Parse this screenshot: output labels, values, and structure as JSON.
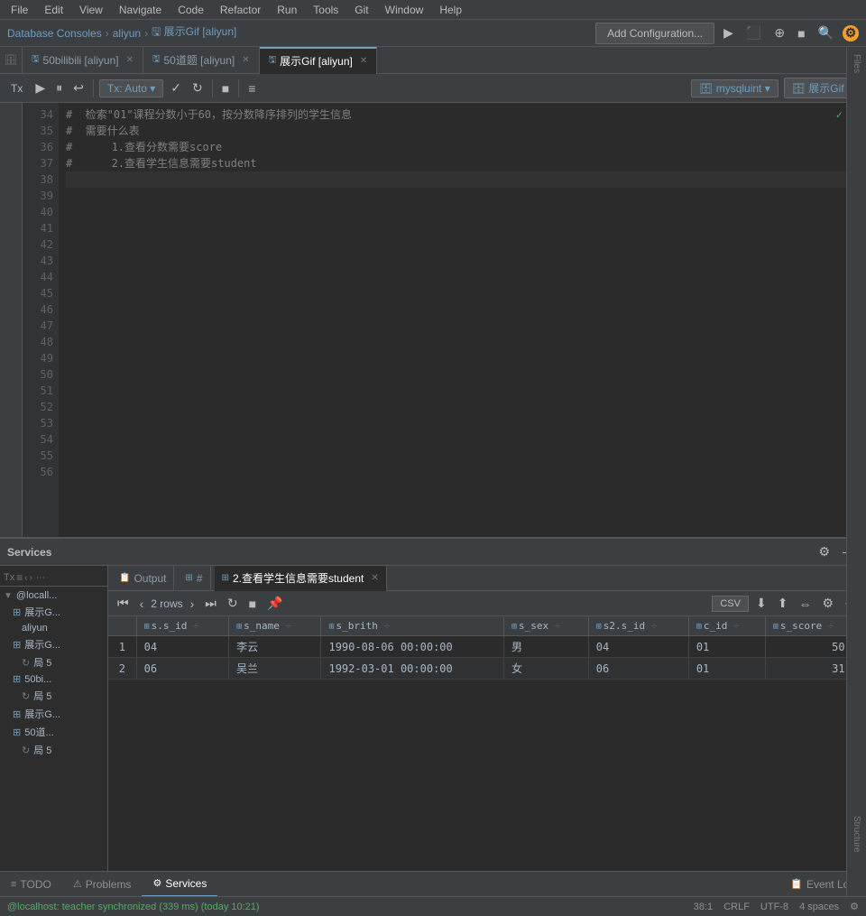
{
  "menu": {
    "items": [
      "File",
      "Edit",
      "View",
      "Navigate",
      "Code",
      "Refactor",
      "Run",
      "Tools",
      "Git",
      "Window",
      "Help"
    ]
  },
  "titlebar": {
    "breadcrumb": [
      "Database Consoles",
      "aliyun",
      "展示Gif [aliyun]"
    ],
    "add_config_label": "Add Configuration...",
    "run_icon": "▶",
    "db_label": "mysqluint",
    "schema_label": "展示Gif"
  },
  "editor_tabs": [
    {
      "label": "50bilibili [aliyun]",
      "active": false
    },
    {
      "label": "50道题 [aliyun]",
      "active": false
    },
    {
      "label": "展示Gif [aliyun]",
      "active": true
    }
  ],
  "toolbar": {
    "tx_label": "Tx",
    "auto_label": "Auto",
    "execute_label": "▶",
    "format_label": "≡"
  },
  "code_lines": [
    {
      "num": 34,
      "text": "#  检索\"01\"课程分数小于60，按分数降序排列的学生信息",
      "type": "comment",
      "check": true
    },
    {
      "num": 35,
      "text": "#  需要什么表",
      "type": "comment"
    },
    {
      "num": 36,
      "text": "#      1.查看分数需要score",
      "type": "comment"
    },
    {
      "num": 37,
      "text": "#      2.查看学生信息需要student",
      "type": "comment"
    },
    {
      "num": 38,
      "text": "",
      "type": "empty",
      "active": true
    },
    {
      "num": 39,
      "text": "",
      "type": "empty"
    },
    {
      "num": 40,
      "text": "",
      "type": "empty"
    },
    {
      "num": 41,
      "text": "",
      "type": "empty"
    },
    {
      "num": 42,
      "text": "",
      "type": "empty"
    },
    {
      "num": 43,
      "text": "",
      "type": "empty"
    },
    {
      "num": 44,
      "text": "",
      "type": "empty"
    },
    {
      "num": 45,
      "text": "",
      "type": "empty"
    },
    {
      "num": 46,
      "text": "",
      "type": "empty"
    },
    {
      "num": 47,
      "text": "",
      "type": "empty"
    },
    {
      "num": 48,
      "text": "",
      "type": "empty"
    },
    {
      "num": 49,
      "text": "",
      "type": "empty"
    },
    {
      "num": 50,
      "text": "",
      "type": "empty"
    },
    {
      "num": 51,
      "text": "",
      "type": "empty"
    },
    {
      "num": 52,
      "text": "",
      "type": "empty"
    },
    {
      "num": 53,
      "text": "",
      "type": "empty"
    },
    {
      "num": 54,
      "text": "",
      "type": "empty"
    },
    {
      "num": 55,
      "text": "",
      "type": "empty"
    },
    {
      "num": 56,
      "text": "",
      "type": "empty"
    }
  ],
  "services": {
    "title": "Services",
    "sidebar_items": [
      {
        "label": "Tx ≡",
        "type": "controls"
      },
      {
        "label": "@locall...",
        "indent": 0
      },
      {
        "label": "展示G...",
        "indent": 1
      },
      {
        "label": "aliyun",
        "indent": 2
      },
      {
        "label": "展示G...",
        "indent": 1
      },
      {
        "label": "局 5",
        "indent": 2
      },
      {
        "label": "50bi...",
        "indent": 1
      },
      {
        "label": "局 5",
        "indent": 2
      },
      {
        "label": "展示G...",
        "indent": 1
      },
      {
        "label": "50道...",
        "indent": 1
      },
      {
        "label": "局 5",
        "indent": 2
      }
    ],
    "tabs": [
      {
        "label": "Output",
        "active": false
      },
      {
        "label": "#",
        "active": false
      },
      {
        "label": "2.查看学生信息需要student",
        "active": true
      }
    ],
    "table": {
      "rows_info": "2 rows",
      "csv_label": "CSV",
      "columns": [
        "s.s_id",
        "s_name",
        "s_brith",
        "s_sex",
        "s2.s_id",
        "c_id",
        "s_score"
      ],
      "rows": [
        {
          "num": 1,
          "s_id": "04",
          "s_name": "李云",
          "s_brith": "1990-08-06 00:00:00",
          "s_sex": "男",
          "s2_id": "04",
          "c_id": "01",
          "s_score": "50.0"
        },
        {
          "num": 2,
          "s_id": "06",
          "s_name": "吴兰",
          "s_brith": "1992-03-01 00:00:00",
          "s_sex": "女",
          "s2_id": "06",
          "c_id": "01",
          "s_score": "31.0"
        }
      ]
    }
  },
  "bottom_tabs": [
    {
      "label": "TODO",
      "icon": "≡"
    },
    {
      "label": "Problems",
      "icon": "⚠"
    },
    {
      "label": "Services",
      "icon": "⚙",
      "active": true
    },
    {
      "label": "Event Log",
      "icon": "📋"
    }
  ],
  "status_bar": {
    "left": "@localhost: teacher synchronized (339 ms) (today 10:21)",
    "position": "38:1",
    "line_sep": "CRLF",
    "encoding": "UTF-8",
    "indent": "4 spaces"
  }
}
